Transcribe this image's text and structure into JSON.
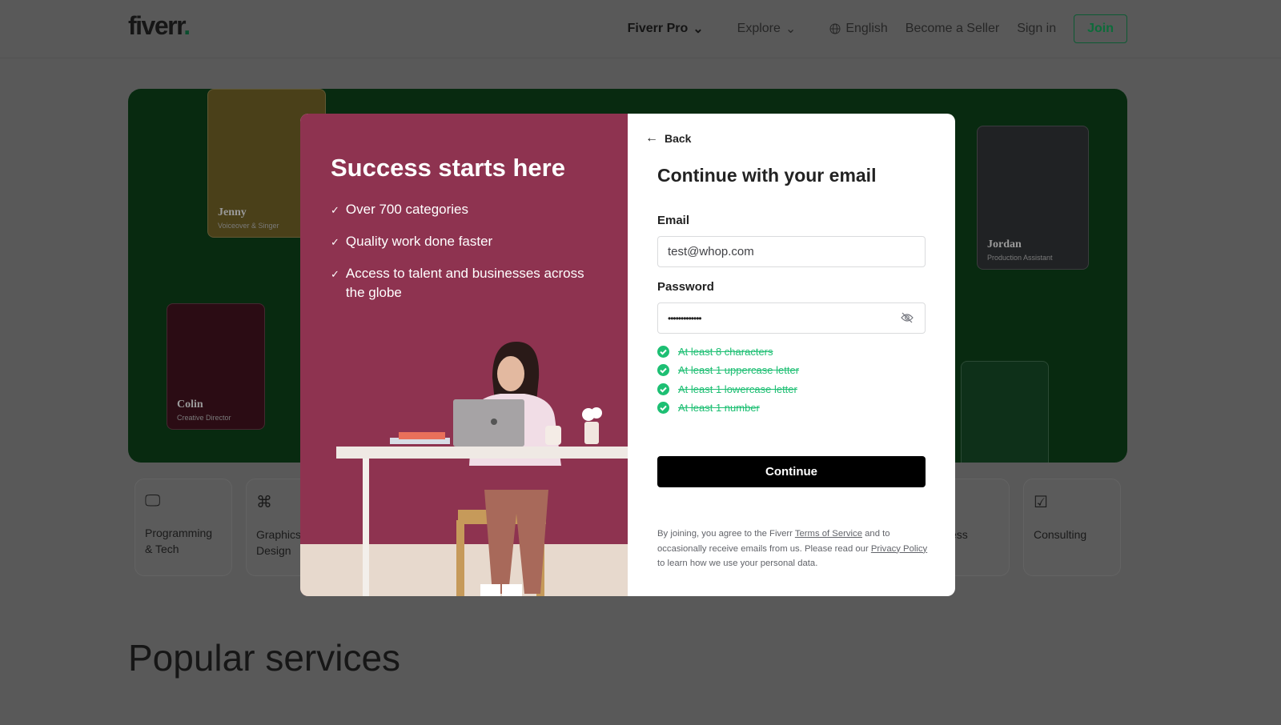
{
  "header": {
    "logo": "fiverr",
    "logo_dot": ".",
    "nav": {
      "fiverr_pro": "Fiverr Pro",
      "explore": "Explore",
      "language": "English",
      "become_seller": "Become a Seller",
      "sign_in": "Sign in",
      "join": "Join"
    }
  },
  "hero": {
    "people": [
      {
        "name": "Jenny",
        "role": "Voiceover & Singer"
      },
      {
        "name": "Colin",
        "role": "Creative Director"
      },
      {
        "name": "Jordan",
        "role": "Production Assistant"
      }
    ]
  },
  "categories": [
    {
      "label": "Programming & Tech",
      "icon": "monitor-icon"
    },
    {
      "label": "Graphics & Design",
      "icon": "design-icon"
    },
    {
      "label": "Business",
      "icon": "briefcase-icon"
    },
    {
      "label": "Consulting",
      "icon": "consulting-icon"
    }
  ],
  "popular_title": "Popular services",
  "modal": {
    "left": {
      "title": "Success starts here",
      "bullets": [
        "Over 700 categories",
        "Quality work done faster",
        "Access to talent and businesses across the globe"
      ],
      "bg": "#8e3350"
    },
    "back": "Back",
    "title": "Continue with your email",
    "email_label": "Email",
    "email_value": "test@whop.com",
    "password_label": "Password",
    "password_value": "•••••••••••••",
    "rules": [
      "At least 8 characters",
      "At least 1 uppercase letter",
      "At least 1 lowercase letter",
      "At least 1 number"
    ],
    "rules_met": [
      true,
      true,
      true,
      true
    ],
    "continue": "Continue",
    "terms": {
      "p1": "By joining, you agree to the Fiverr ",
      "tos": "Terms of Service",
      "p2": " and to occasionally receive emails from us. Please read our ",
      "privacy": "Privacy Policy",
      "p3": " to learn how we use your personal data."
    }
  },
  "colors": {
    "accent": "#1dbf73",
    "button": "#000000"
  }
}
